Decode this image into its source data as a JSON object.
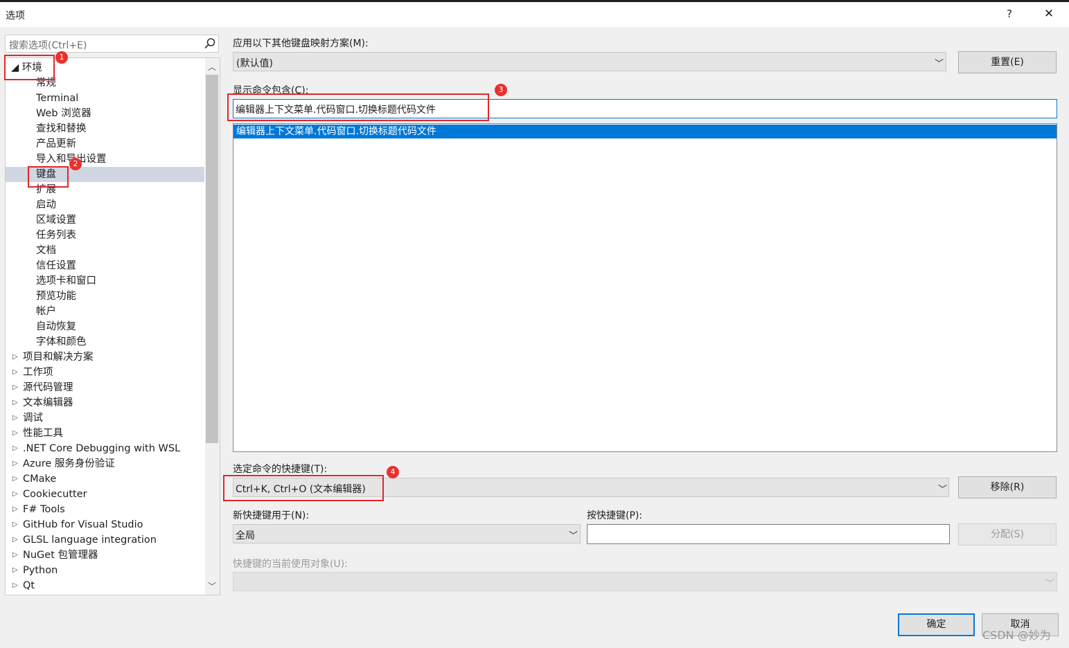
{
  "window": {
    "title": "选项",
    "help": "?",
    "close": "✕"
  },
  "search": {
    "placeholder": "搜索选项(Ctrl+E)"
  },
  "tree": {
    "items": [
      {
        "label": "◢ 环境",
        "arrow": "",
        "depth": 0
      },
      {
        "label": "常规"
      },
      {
        "label": "Terminal"
      },
      {
        "label": "Web 浏览器"
      },
      {
        "label": "查找和替换"
      },
      {
        "label": "产品更新"
      },
      {
        "label": "导入和导出设置"
      },
      {
        "label": "键盘"
      },
      {
        "label": "扩展"
      },
      {
        "label": "启动"
      },
      {
        "label": "区域设置"
      },
      {
        "label": "任务列表"
      },
      {
        "label": "文档"
      },
      {
        "label": "信任设置"
      },
      {
        "label": "选项卡和窗口"
      },
      {
        "label": "预览功能"
      },
      {
        "label": "帐户"
      },
      {
        "label": "自动恢复"
      },
      {
        "label": "字体和颜色"
      },
      {
        "label": "项目和解决方案"
      },
      {
        "label": "工作项"
      },
      {
        "label": "源代码管理"
      },
      {
        "label": "文本编辑器"
      },
      {
        "label": "调试"
      },
      {
        "label": "性能工具"
      },
      {
        "label": ".NET Core Debugging with WSL"
      },
      {
        "label": "Azure 服务身份验证"
      },
      {
        "label": "CMake"
      },
      {
        "label": "Cookiecutter"
      },
      {
        "label": "F# Tools"
      },
      {
        "label": "GitHub for Visual Studio"
      },
      {
        "label": "GLSL language integration"
      },
      {
        "label": "NuGet 包管理器"
      },
      {
        "label": "Python"
      },
      {
        "label": "Qt"
      }
    ]
  },
  "keyboard": {
    "mapping_label": "应用以下其他键盘映射方案(M):",
    "mapping_value": "(默认值)",
    "reset_button": "重置(E)",
    "filter_label": "显示命令包含(C):",
    "filter_value": "编辑器上下文菜单.代码窗口.切换标题代码文件",
    "command_list": [
      "编辑器上下文菜单.代码窗口.切换标题代码文件"
    ],
    "shortcut_label": "选定命令的快捷键(T):",
    "shortcut_value": "Ctrl+K, Ctrl+O (文本编辑器)",
    "remove_button": "移除(R)",
    "new_scope_label": "新快捷键用于(N):",
    "new_scope_value": "全局",
    "press_label": "按快捷键(P):",
    "press_value": "",
    "assign_button": "分配(S)",
    "used_by_label": "快捷键的当前使用对象(U):",
    "used_by_value": ""
  },
  "footer": {
    "ok_button": "确定",
    "cancel_button": "取消"
  },
  "annotations": {
    "b1": "1",
    "b2": "2",
    "b3": "3",
    "b4": "4"
  },
  "watermark": "CSDN @妙为",
  "colors": {
    "selection": "#0078d7",
    "annotation": "#e0272a"
  }
}
